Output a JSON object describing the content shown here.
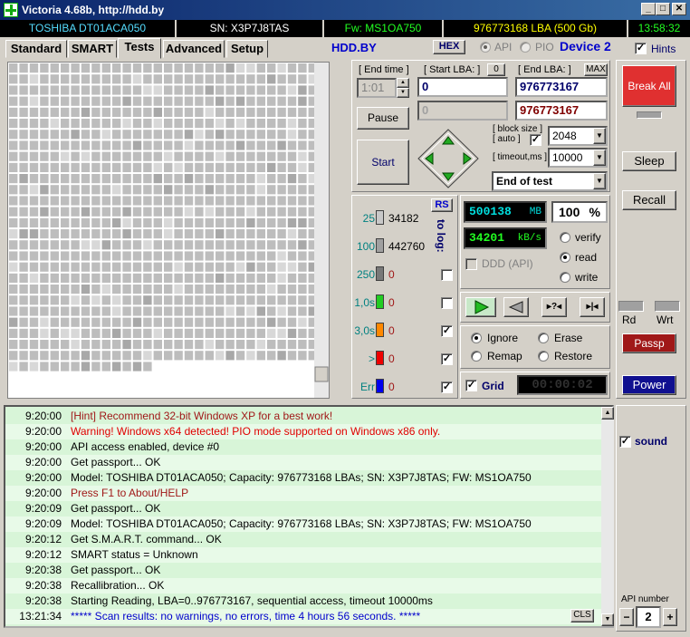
{
  "window": {
    "title": "Victoria 4.68b, http://hdd.by"
  },
  "infobar": {
    "model": "TOSHIBA DT01ACA050",
    "serial": "SN: X3P7J8TAS",
    "firmware": "Fw: MS1OA750",
    "capacity": "976773168 LBA (500 Gb)",
    "clock": "13:58:32"
  },
  "tabs": [
    "Standard",
    "SMART",
    "Tests",
    "Advanced",
    "Setup"
  ],
  "tabs_active": "Tests",
  "header": {
    "site": "HDD.BY",
    "hex_label": "HEX",
    "api_label": "API",
    "pio_label": "PIO",
    "device": "Device 2",
    "hints_label": "Hints"
  },
  "test_controls": {
    "end_time_label": "[ End time ]",
    "end_time_value": "1:01",
    "start_lba_label": "[ Start LBA: ]",
    "start_lba_zero": "0",
    "start_lba_value": "0",
    "end_lba_label": "[ End LBA: ]",
    "end_lba_max": "MAX",
    "end_lba_value": "976773167",
    "current_lba_left": "0",
    "current_lba_right": "976773167",
    "pause_label": "Pause",
    "start_label": "Start",
    "block_size_label_1": "[ block size ]",
    "block_size_label_2": "[ auto ]",
    "block_size_value": "2048",
    "timeout_label": "[ timeout,ms ]",
    "timeout_value": "10000",
    "end_action": "End of test"
  },
  "stats": {
    "rs_label": "RS",
    "to_log_label": "to log:",
    "rows": [
      {
        "label": "25",
        "count": "34182",
        "color": "#c8c8c8",
        "log": false
      },
      {
        "label": "100",
        "count": "442760",
        "color": "#a0a0a0",
        "log": false
      },
      {
        "label": "250",
        "count": "0",
        "color": "#787878",
        "log": false
      },
      {
        "label": "1,0s",
        "count": "0",
        "color": "#22cc22",
        "log": false
      },
      {
        "label": "3,0s",
        "count": "0",
        "color": "#ff8800",
        "log": true
      },
      {
        "label": ">",
        "count": "0",
        "color": "#ee0000",
        "log": true
      },
      {
        "label": "Err",
        "count": "0",
        "color": "#0000ee",
        "log": true
      }
    ]
  },
  "progress": {
    "mb_value": "500138",
    "mb_unit": "MB",
    "percent_value": "100",
    "percent_unit": "%",
    "speed_value": "34201",
    "speed_unit": "kB/s",
    "ddd_label": "DDD (API)",
    "modes": [
      "verify",
      "read",
      "write"
    ],
    "mode_selected": "read"
  },
  "actions": {
    "options": [
      "Ignore",
      "Erase",
      "Remap",
      "Restore"
    ],
    "selected": "Ignore",
    "grid_label": "Grid",
    "timer": "00:00:02"
  },
  "side": {
    "break_all": "Break All",
    "sleep": "Sleep",
    "recall": "Recall",
    "rd": "Rd",
    "wrt": "Wrt",
    "passp": "Passp",
    "power": "Power",
    "sound_label": "sound",
    "api_number_label": "API number",
    "api_number_value": "2",
    "minus": "−",
    "plus": "+"
  },
  "log": {
    "cls_label": "CLS",
    "entries": [
      {
        "time": "9:20:00",
        "msg": "[Hint] Recommend 32-bit Windows XP for a best work!",
        "color": "#a01818"
      },
      {
        "time": "9:20:00",
        "msg": "Warning! Windows x64 detected! PIO mode supported on Windows x86 only.",
        "color": "#e00000"
      },
      {
        "time": "9:20:00",
        "msg": "API access enabled, device #0",
        "color": "#000000"
      },
      {
        "time": "9:20:00",
        "msg": "Get passport... OK",
        "color": "#000000"
      },
      {
        "time": "9:20:00",
        "msg": "Model: TOSHIBA DT01ACA050; Capacity: 976773168 LBAs; SN: X3P7J8TAS; FW: MS1OA750",
        "color": "#000000"
      },
      {
        "time": "9:20:00",
        "msg": "Press F1 to About/HELP",
        "color": "#a01818"
      },
      {
        "time": "9:20:09",
        "msg": "Get passport... OK",
        "color": "#000000"
      },
      {
        "time": "9:20:09",
        "msg": "Model: TOSHIBA DT01ACA050; Capacity: 976773168 LBAs; SN: X3P7J8TAS; FW: MS1OA750",
        "color": "#000000"
      },
      {
        "time": "9:20:12",
        "msg": "Get S.M.A.R.T. command... OK",
        "color": "#000000"
      },
      {
        "time": "9:20:12",
        "msg": "SMART status = Unknown",
        "color": "#000000"
      },
      {
        "time": "9:20:38",
        "msg": "Get passport... OK",
        "color": "#000000"
      },
      {
        "time": "9:20:38",
        "msg": "Recallibration... OK",
        "color": "#000000"
      },
      {
        "time": "9:20:38",
        "msg": "Starting Reading, LBA=0..976773167, sequential access, timeout 10000ms",
        "color": "#000000"
      },
      {
        "time": "13:21:34",
        "msg": "***** Scan results: no warnings, no errors, time 4 hours 56 seconds.  *****",
        "color": "#0000cc"
      }
    ]
  }
}
